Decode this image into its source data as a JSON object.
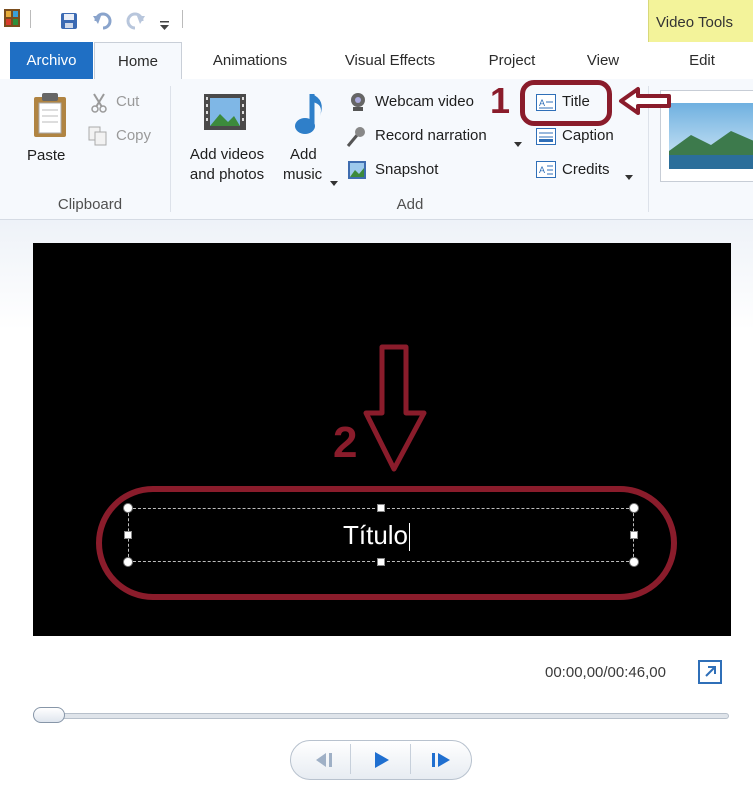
{
  "context_tab": {
    "label": "Video Tools"
  },
  "tabs": [
    {
      "label": "Archivo"
    },
    {
      "label": "Home"
    },
    {
      "label": "Animations"
    },
    {
      "label": "Visual Effects"
    },
    {
      "label": "Project"
    },
    {
      "label": "View"
    },
    {
      "label": "Edit"
    }
  ],
  "clipboard": {
    "paste": "Paste",
    "cut": "Cut",
    "copy": "Copy",
    "group": "Clipboard"
  },
  "add": {
    "add_videos_line1": "Add videos",
    "add_videos_line2": "and photos",
    "add_music_line1": "Add",
    "add_music_line2": "music",
    "webcam": "Webcam video",
    "record": "Record narration",
    "snapshot": "Snapshot",
    "title": "Title",
    "caption": "Caption",
    "credits": "Credits",
    "group": "Add"
  },
  "preview": {
    "title_text": "Título",
    "time": "00:00,00/00:46,00"
  },
  "annotations": {
    "one": "1",
    "two": "2"
  },
  "colors": {
    "annotation": "#8a1c2b",
    "file_tab": "#1f6fc4",
    "context_band": "#f3f39a"
  }
}
